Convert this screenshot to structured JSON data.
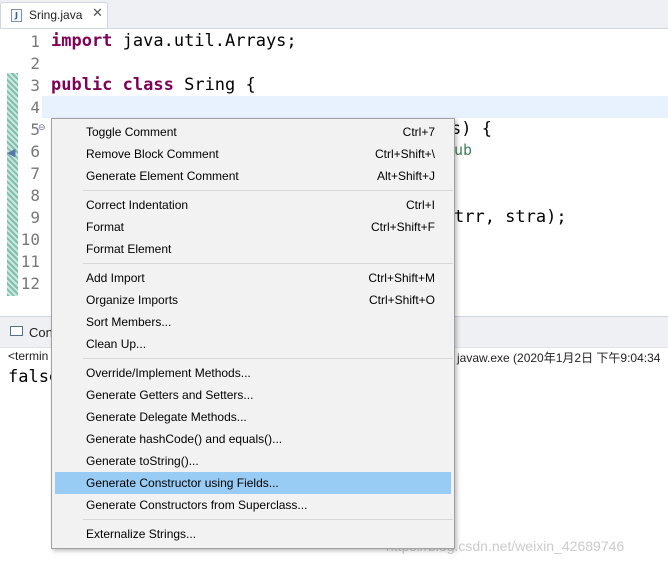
{
  "editor_tab": {
    "filename": "Sring.java",
    "close_glyph": "✕",
    "file_icon": "java-file-icon"
  },
  "editor": {
    "line_numbers": [
      "1",
      "2",
      "3",
      "4",
      "5",
      "6",
      "7",
      "8",
      "9",
      "10",
      "11",
      "12"
    ],
    "code": {
      "l1_kw": "import",
      "l1_rest": " java.util.Arrays;",
      "l3_kw1": "public",
      "l3_kw2": "class",
      "l3_rest": " Sring {",
      "l5_rest": "s) {",
      "l6_rest": "ub",
      "l9_rest": "trr, stra);"
    }
  },
  "console": {
    "label": "Con",
    "desc_left": "<termin",
    "desc_right": "javaw.exe (2020年1月2日 下午9:04:34",
    "output": "false"
  },
  "watermark": "https://blog.csdn.net/weixin_42689746",
  "menu": {
    "items": [
      {
        "label": "Toggle Comment",
        "shortcut": "Ctrl+7"
      },
      {
        "label": "Remove Block Comment",
        "shortcut": "Ctrl+Shift+\\"
      },
      {
        "label": "Generate Element Comment",
        "shortcut": "Alt+Shift+J"
      },
      {
        "label": "Correct Indentation",
        "shortcut": "Ctrl+I"
      },
      {
        "label": "Format",
        "shortcut": "Ctrl+Shift+F"
      },
      {
        "label": "Format Element",
        "shortcut": ""
      },
      {
        "label": "Add Import",
        "shortcut": "Ctrl+Shift+M"
      },
      {
        "label": "Organize Imports",
        "shortcut": "Ctrl+Shift+O"
      },
      {
        "label": "Sort Members...",
        "shortcut": ""
      },
      {
        "label": "Clean Up...",
        "shortcut": ""
      },
      {
        "label": "Override/Implement Methods...",
        "shortcut": ""
      },
      {
        "label": "Generate Getters and Setters...",
        "shortcut": ""
      },
      {
        "label": "Generate Delegate Methods...",
        "shortcut": ""
      },
      {
        "label": "Generate hashCode() and equals()...",
        "shortcut": ""
      },
      {
        "label": "Generate toString()...",
        "shortcut": ""
      },
      {
        "label": "Generate Constructor using Fields...",
        "shortcut": ""
      },
      {
        "label": "Generate Constructors from Superclass...",
        "shortcut": ""
      },
      {
        "label": "Externalize Strings...",
        "shortcut": ""
      }
    ],
    "selected_item": "Generate Constructor using Fields...",
    "colors": {
      "background": "#f2f2f2",
      "selection": "#99ccf5"
    }
  }
}
